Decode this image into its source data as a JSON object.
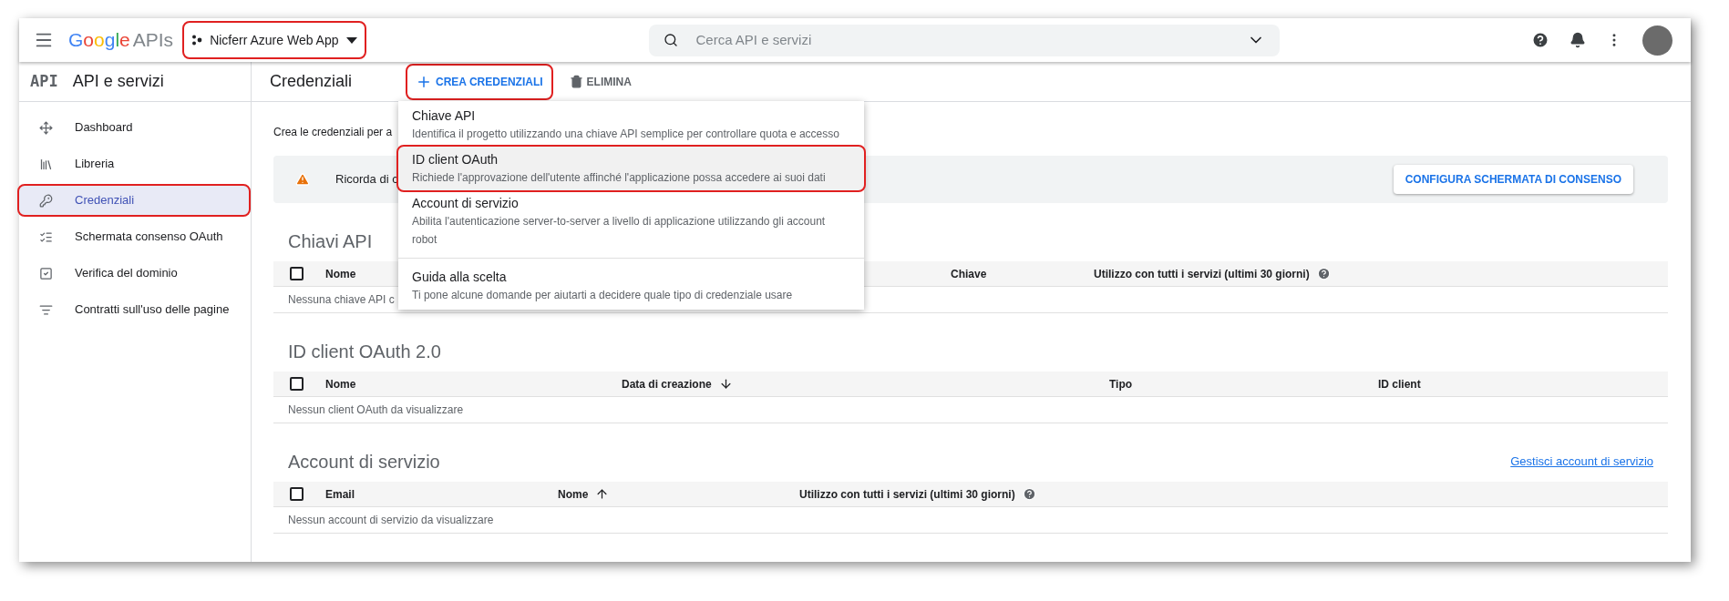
{
  "header": {
    "logo_brand": "Google",
    "logo_product": "APIs",
    "project": {
      "name": "Nicferr Azure Web App",
      "highlighted": true
    },
    "search": {
      "placeholder": "Cerca API e servizi"
    }
  },
  "sidebar": {
    "logo": "API",
    "title": "API e servizi",
    "items": [
      {
        "label": "Dashboard",
        "selected": false,
        "highlighted": false
      },
      {
        "label": "Libreria",
        "selected": false,
        "highlighted": false
      },
      {
        "label": "Credenziali",
        "selected": true,
        "highlighted": true
      },
      {
        "label": "Schermata consenso OAuth",
        "selected": false,
        "highlighted": false
      },
      {
        "label": "Verifica del dominio",
        "selected": false,
        "highlighted": false
      },
      {
        "label": "Contratti sull'uso delle pagine",
        "selected": false,
        "highlighted": false
      }
    ]
  },
  "toolbar": {
    "title": "Credenziali",
    "create_button": {
      "label": "CREA CREDENZIALI",
      "highlighted": true
    },
    "delete_button": {
      "label": "ELIMINA"
    }
  },
  "intro": "Crea le credenziali per a",
  "banner": {
    "text": "Ricorda di c",
    "button": "CONFIGURA SCHERMATA DI CONSENSO"
  },
  "create_menu": {
    "items": [
      {
        "title": "Chiave API",
        "description": "Identifica il progetto utilizzando una chiave API semplice per controllare quota e accesso",
        "highlighted": false,
        "separated": false
      },
      {
        "title": "ID client OAuth",
        "description": "Richiede l'approvazione dell'utente affinché l'applicazione possa accedere ai suoi dati",
        "highlighted": true,
        "separated": false
      },
      {
        "title": "Account di servizio",
        "description": "Abilita l'autenticazione server-to-server a livello di applicazione utilizzando gli account robot",
        "highlighted": false,
        "separated": false
      },
      {
        "title": "Guida alla scelta",
        "description": "Ti pone alcune domande per aiutarti a decidere quale tipo di credenziale usare",
        "highlighted": false,
        "separated": true
      }
    ]
  },
  "sections": [
    {
      "title": "Chiavi API",
      "all_checked": false,
      "columns": [
        {
          "label": "Nome"
        },
        {
          "label": "Chiave"
        },
        {
          "label": "Utilizzo con tutti i servizi (ultimi 30 giorni)",
          "help": true
        }
      ],
      "empty_text": "Nessuna chiave API c"
    },
    {
      "title": "ID client OAuth 2.0",
      "all_checked": false,
      "columns": [
        {
          "label": "Nome"
        },
        {
          "label": "Data di creazione",
          "descending": true
        },
        {
          "label": "Tipo"
        },
        {
          "label": "ID client"
        }
      ],
      "empty_text": "Nessun client OAuth da visualizzare"
    },
    {
      "title": "Account di servizio",
      "link": "Gestisci account di servizio",
      "all_checked": false,
      "columns": [
        {
          "label": "Email"
        },
        {
          "label": "Nome",
          "descending": false
        },
        {
          "label": "Utilizzo con tutti i servizi (ultimi 30 giorni)",
          "help": true
        }
      ],
      "empty_text": "Nessun account di servizio da visualizzare"
    }
  ]
}
